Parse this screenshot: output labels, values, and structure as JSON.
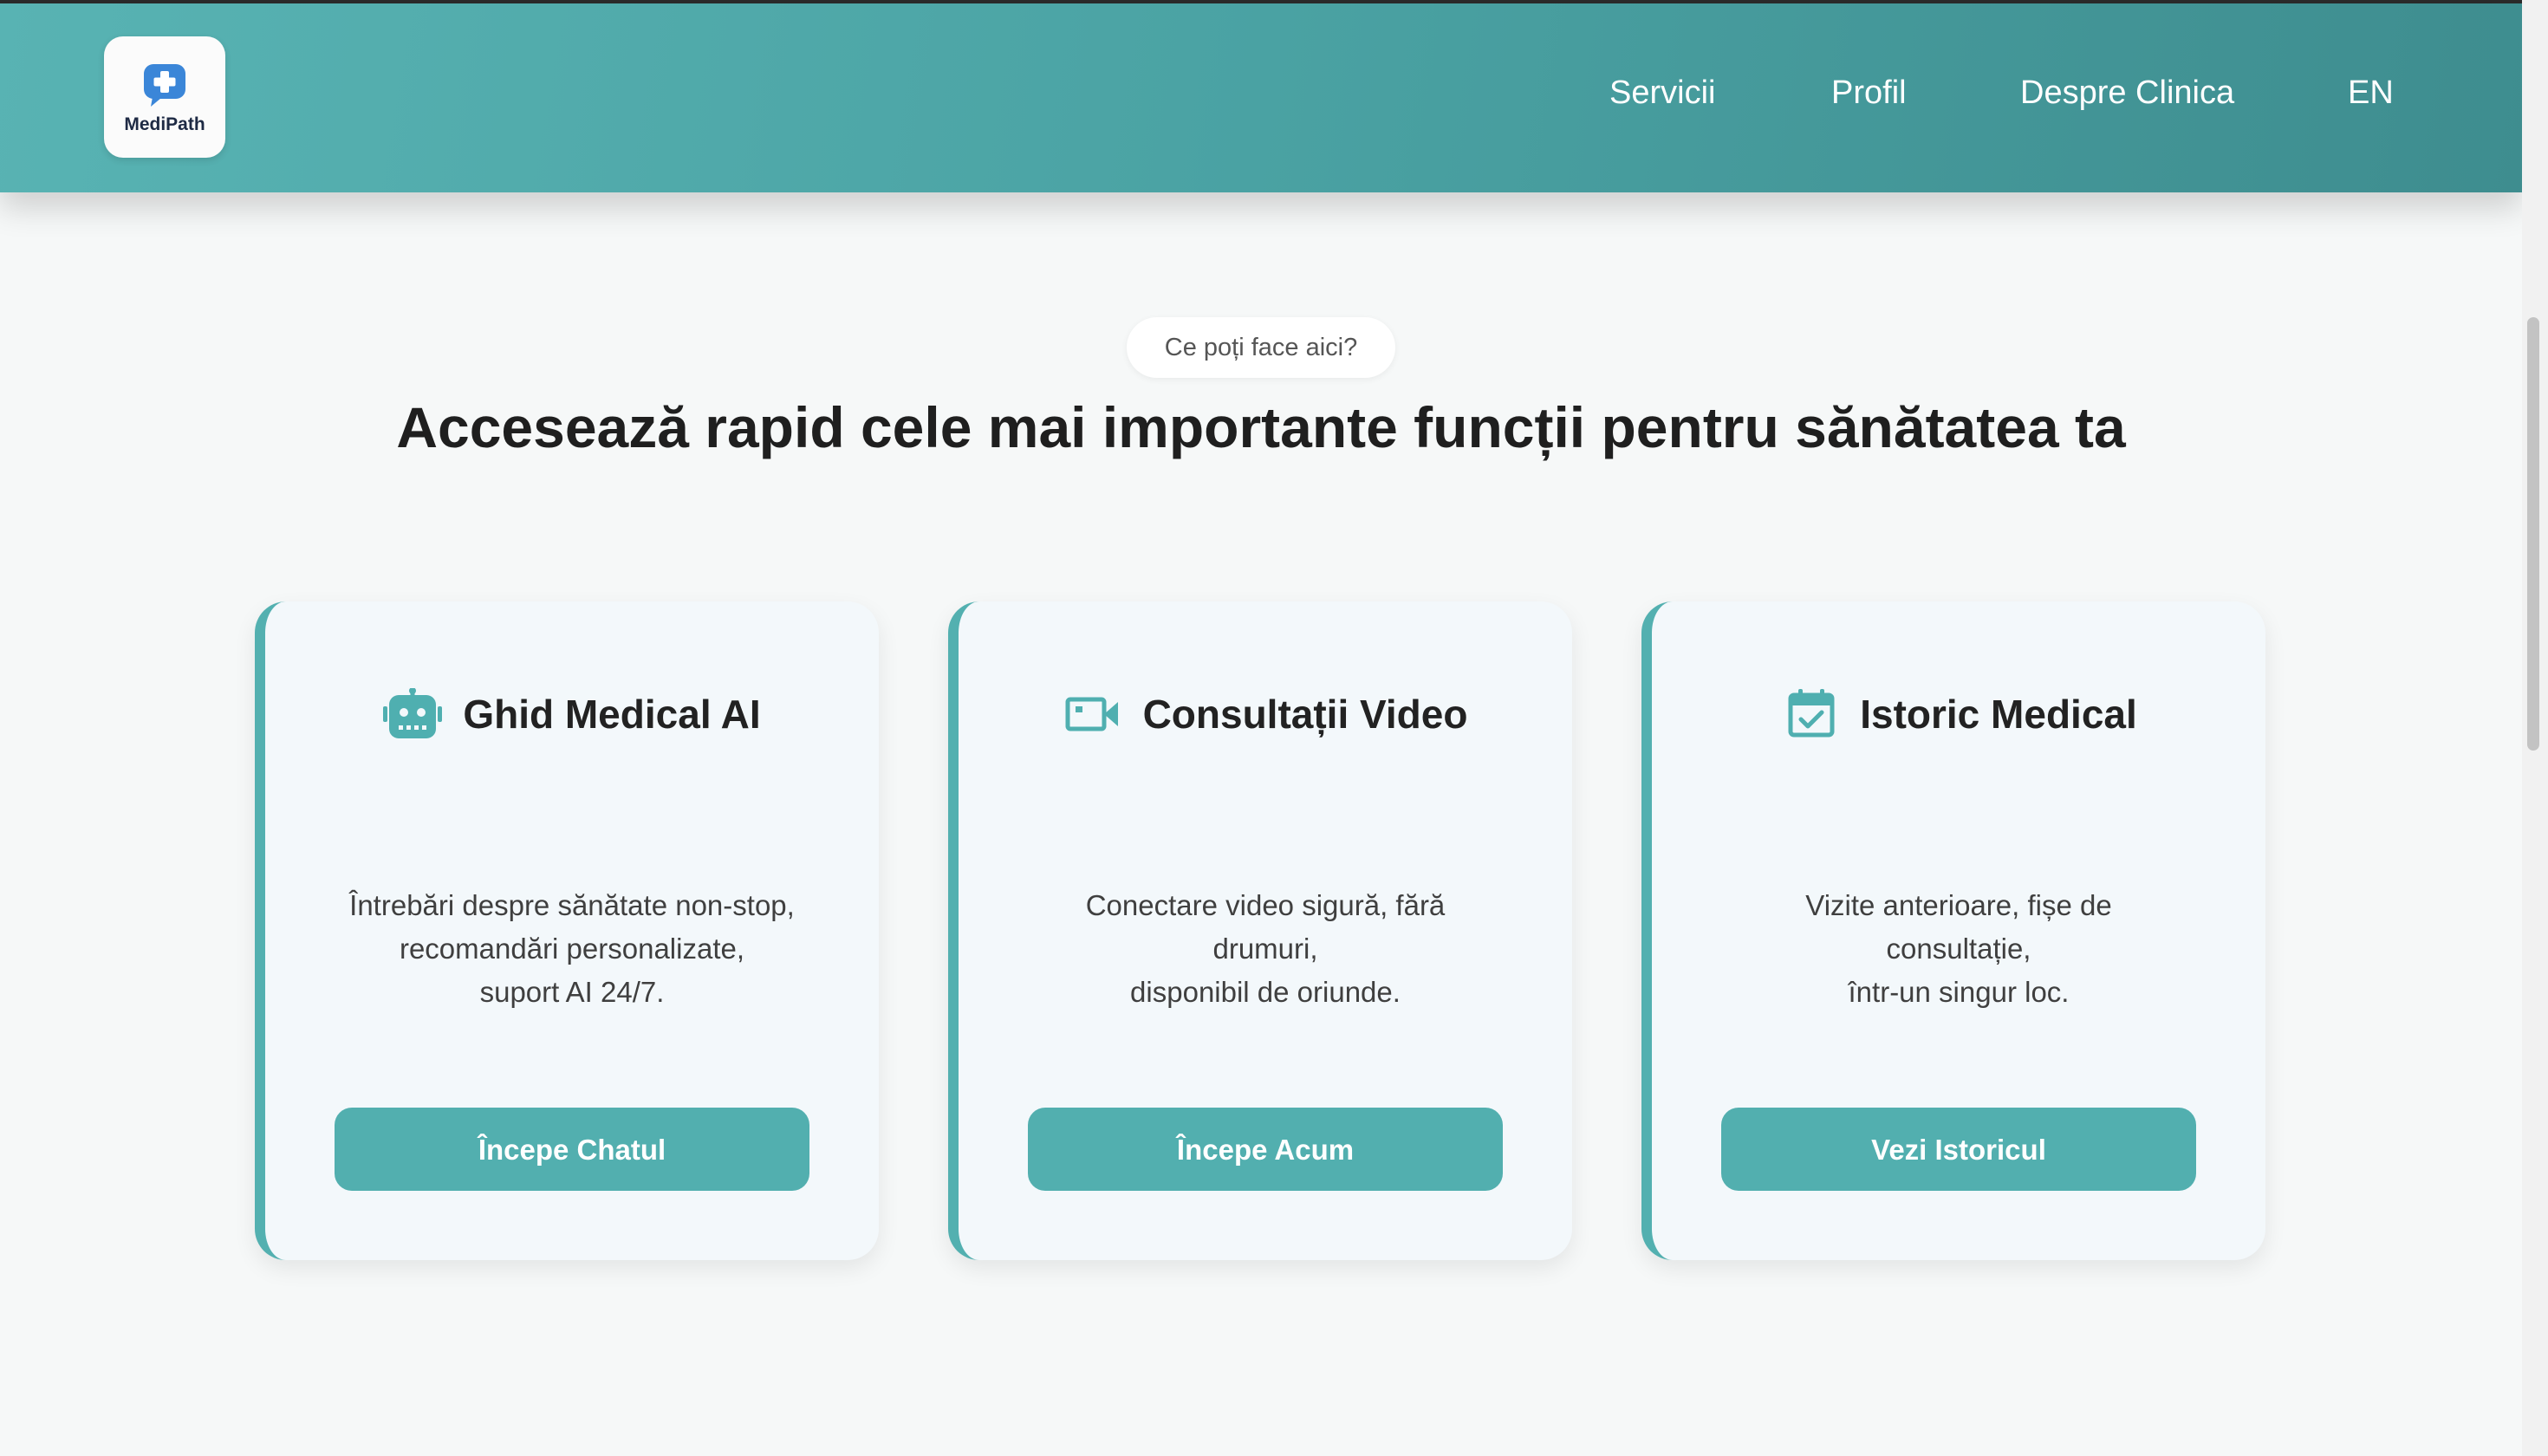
{
  "header": {
    "logo_text": "MediPath",
    "nav": [
      "Servicii",
      "Profil",
      "Despre Clinica",
      "EN"
    ]
  },
  "intro": {
    "badge": "Ce poți face aici?",
    "headline": "Accesează rapid cele mai importante funcții pentru sănătatea ta"
  },
  "cards": [
    {
      "icon": "robot-icon",
      "title": "Ghid Medical AI",
      "desc": [
        "Întrebări despre sănătate non-stop,",
        "recomandări personalizate,",
        "suport AI 24/7."
      ],
      "button": "Începe Chatul"
    },
    {
      "icon": "video-camera-icon",
      "title": "Consultații Video",
      "desc": [
        "Conectare video sigură, fără",
        "drumuri,",
        "disponibil de oriunde."
      ],
      "button": "Începe Acum"
    },
    {
      "icon": "calendar-check-icon",
      "title": "Istoric Medical",
      "desc": [
        "Vizite anterioare, fișe de",
        "consultație,",
        "într-un singur loc."
      ],
      "button": "Vezi Istoricul"
    }
  ],
  "colors": {
    "accent": "#52afaf",
    "header_start": "#58b3b3",
    "header_end": "#3e8d8f",
    "logo_blue": "#3b86d8",
    "page_bg": "#f6f8f8"
  }
}
